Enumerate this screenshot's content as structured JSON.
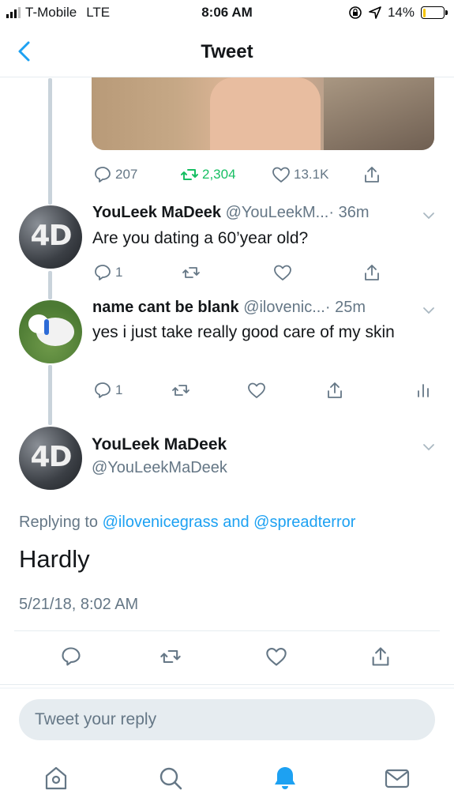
{
  "status": {
    "carrier": "T-Mobile",
    "network": "LTE",
    "time": "8:06 AM",
    "battery": "14%",
    "battery_level": 0.14
  },
  "nav": {
    "title": "Tweet"
  },
  "parent_tweet_actions": {
    "replies": "207",
    "retweets": "2,304",
    "likes": "13.1K"
  },
  "reply1": {
    "name": "YouLeek MaDeek",
    "handle": "@YouLeekM...",
    "time": "· 36m",
    "text": "Are you dating a 60’year old?",
    "replies": "1"
  },
  "reply2": {
    "name": "name cant be blank",
    "handle": "@ilovenic...",
    "time": "· 25m",
    "text": "yes i just take really good care of my skin",
    "replies": "1"
  },
  "main_tweet": {
    "name": "YouLeek MaDeek",
    "handle": "@YouLeekMaDeek",
    "replying_prefix": "Replying to",
    "replying_user1": "@ilovenicegrass",
    "replying_and": "and",
    "replying_user2": "@spreadterror",
    "text": "Hardly",
    "timestamp": "5/21/18, 8:02 AM"
  },
  "reply_box": {
    "placeholder": "Tweet your reply"
  },
  "colors": {
    "accent": "#1da1f2",
    "retweet": "#17bf63",
    "secondary": "#657786",
    "divider": "#e6ecf0"
  }
}
